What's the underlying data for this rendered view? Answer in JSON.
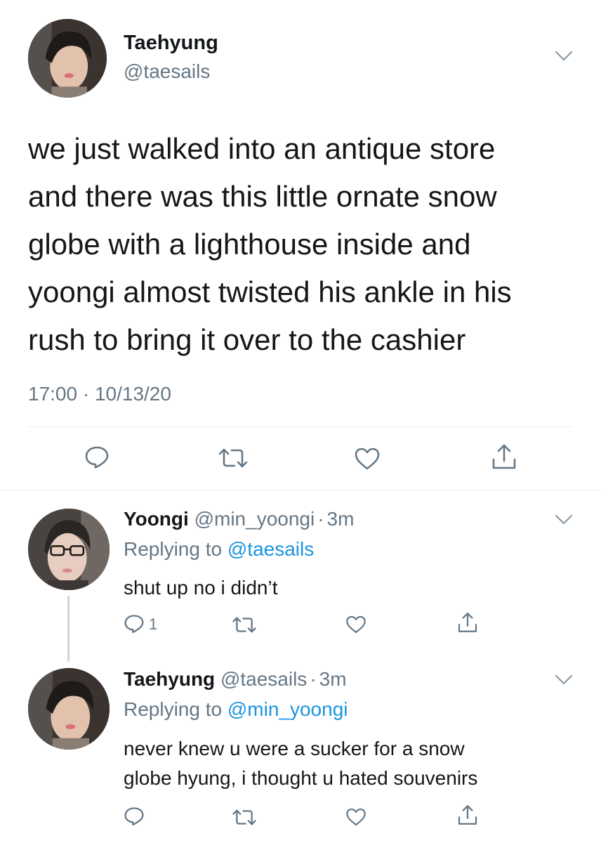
{
  "main_tweet": {
    "display_name": "Taehyung",
    "handle": "@taesails",
    "text_lines": [
      "we just walked into an antique store",
      "and there was this little ornate snow",
      "globe with a lighthouse inside and",
      "yoongi almost twisted his ankle in his",
      "rush to bring it over to the cashier"
    ],
    "timestamp": "17:00 · 10/13/20"
  },
  "replies": [
    {
      "display_name": "Yoongi",
      "handle": "@min_yoongi",
      "separator": "·",
      "time": "3m",
      "replying_prefix": "Replying to",
      "replying_to": "@taesails",
      "text_lines": [
        "shut up no i didn’t"
      ],
      "reply_count": "1"
    },
    {
      "display_name": "Taehyung",
      "handle": "@taesails",
      "separator": "·",
      "time": "3m",
      "replying_prefix": "Replying to",
      "replying_to": "@min_yoongi",
      "text_lines": [
        "never knew u were a sucker for a snow",
        "globe hyung, i thought u hated souvenirs"
      ],
      "reply_count": ""
    }
  ],
  "icons": {
    "reply": "reply-icon",
    "retweet": "retweet-icon",
    "like": "like-icon",
    "share": "share-icon",
    "menu": "chevron-down-icon"
  },
  "colors": {
    "text": "#14171a",
    "secondary": "#657786",
    "link": "#1b95e0",
    "divider": "#e6ecf0"
  }
}
